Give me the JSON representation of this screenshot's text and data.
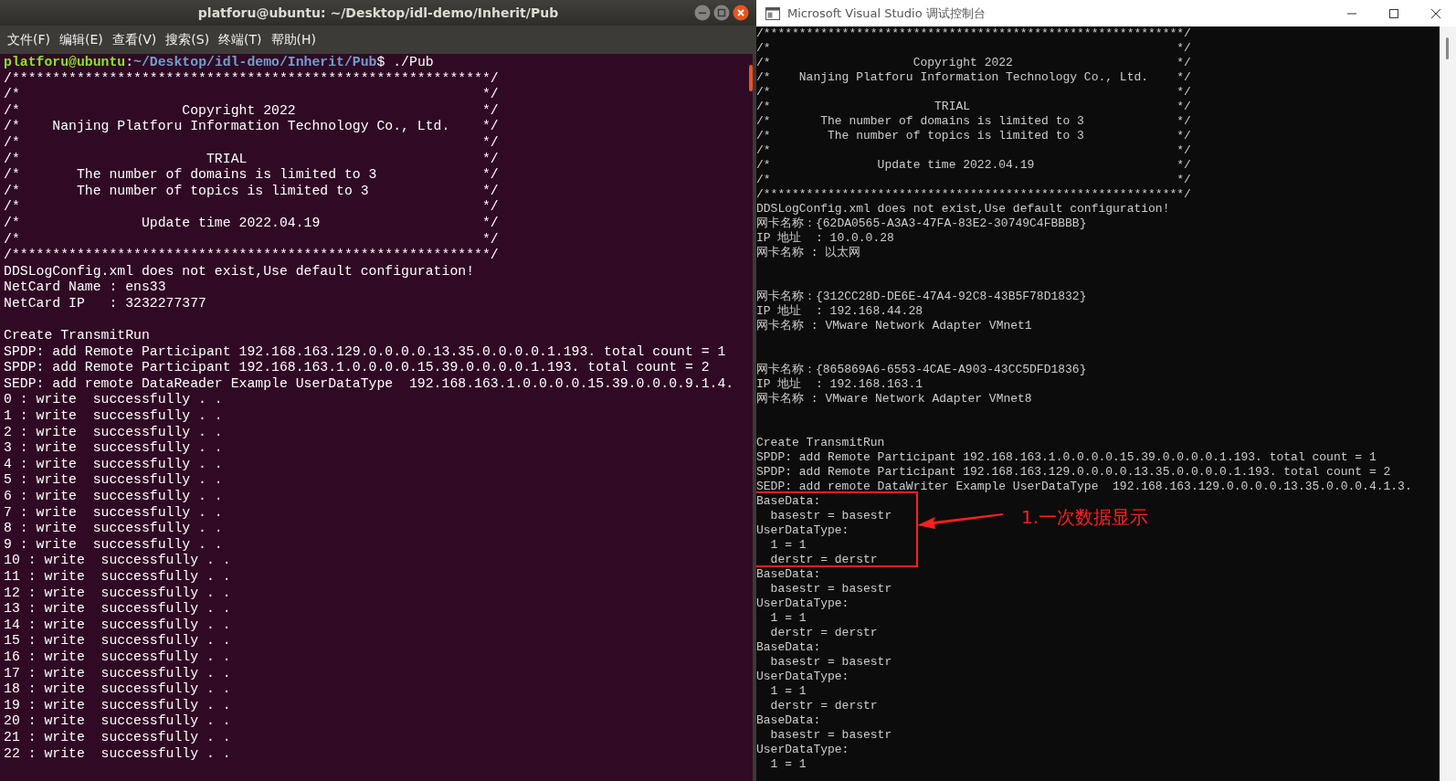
{
  "left_window": {
    "title": "platforu@ubuntu: ~/Desktop/idl-demo/Inherit/Pub",
    "menu": [
      {
        "label": "文件(F)"
      },
      {
        "label": "编辑(E)"
      },
      {
        "label": "查看(V)"
      },
      {
        "label": "搜索(S)"
      },
      {
        "label": "终端(T)"
      },
      {
        "label": "帮助(H)"
      }
    ],
    "prompt": {
      "user_host": "platforu@ubuntu",
      "separator": ":",
      "path": "~/Desktop/idl-demo/Inherit/Pub",
      "symbol": "$",
      "command": " ./Pub"
    },
    "lines": [
      {
        "kind": "text",
        "text": "/***********************************************************/"
      },
      {
        "kind": "text",
        "text": "/*                                                         */"
      },
      {
        "kind": "text",
        "text": "/*                    Copyright 2022                       */"
      },
      {
        "kind": "text",
        "text": "/*    Nanjing Platforu Information Technology Co., Ltd.    */"
      },
      {
        "kind": "text",
        "text": "/*                                                         */"
      },
      {
        "kind": "text",
        "text": "/*                       TRIAL                             */"
      },
      {
        "kind": "text",
        "text": "/*       The number of domains is limited to 3             */"
      },
      {
        "kind": "text",
        "text": "/*       The number of topics is limited to 3              */"
      },
      {
        "kind": "text",
        "text": "/*                                                         */"
      },
      {
        "kind": "text",
        "text": "/*               Update time 2022.04.19                    */"
      },
      {
        "kind": "text",
        "text": "/*                                                         */"
      },
      {
        "kind": "text",
        "text": "/***********************************************************/"
      },
      {
        "kind": "text",
        "text": "DDSLogConfig.xml does not exist,Use default configuration!"
      },
      {
        "kind": "text",
        "text": "NetCard Name : ens33"
      },
      {
        "kind": "text",
        "text": "NetCard IP   : 3232277377"
      },
      {
        "kind": "blank"
      },
      {
        "kind": "text",
        "text": "Create TransmitRun"
      },
      {
        "kind": "text",
        "text": "SPDP: add Remote Participant 192.168.163.129.0.0.0.0.13.35.0.0.0.0.1.193. total count = 1"
      },
      {
        "kind": "text",
        "text": "SPDP: add Remote Participant 192.168.163.1.0.0.0.0.15.39.0.0.0.0.1.193. total count = 2"
      },
      {
        "kind": "text",
        "text": "SEDP: add remote DataReader Example UserDataType  192.168.163.1.0.0.0.0.15.39.0.0.0.9.1.4."
      },
      {
        "kind": "text",
        "text": "0 : write  successfully . ."
      },
      {
        "kind": "text",
        "text": "1 : write  successfully . ."
      },
      {
        "kind": "text",
        "text": "2 : write  successfully . ."
      },
      {
        "kind": "text",
        "text": "3 : write  successfully . ."
      },
      {
        "kind": "text",
        "text": "4 : write  successfully . ."
      },
      {
        "kind": "text",
        "text": "5 : write  successfully . ."
      },
      {
        "kind": "text",
        "text": "6 : write  successfully . ."
      },
      {
        "kind": "text",
        "text": "7 : write  successfully . ."
      },
      {
        "kind": "text",
        "text": "8 : write  successfully . ."
      },
      {
        "kind": "text",
        "text": "9 : write  successfully . ."
      },
      {
        "kind": "text",
        "text": "10 : write  successfully . ."
      },
      {
        "kind": "text",
        "text": "11 : write  successfully . ."
      },
      {
        "kind": "text",
        "text": "12 : write  successfully . ."
      },
      {
        "kind": "text",
        "text": "13 : write  successfully . ."
      },
      {
        "kind": "text",
        "text": "14 : write  successfully . ."
      },
      {
        "kind": "text",
        "text": "15 : write  successfully . ."
      },
      {
        "kind": "text",
        "text": "16 : write  successfully . ."
      },
      {
        "kind": "text",
        "text": "17 : write  successfully . ."
      },
      {
        "kind": "text",
        "text": "18 : write  successfully . ."
      },
      {
        "kind": "text",
        "text": "19 : write  successfully . ."
      },
      {
        "kind": "text",
        "text": "20 : write  successfully . ."
      },
      {
        "kind": "text",
        "text": "21 : write  successfully . ."
      },
      {
        "kind": "text",
        "text": "22 : write  successfully . ."
      }
    ]
  },
  "right_window": {
    "title": "Microsoft Visual Studio 调试控制台",
    "lines": [
      {
        "kind": "text",
        "text": "/***********************************************************/"
      },
      {
        "kind": "text",
        "text": "/*                                                         */"
      },
      {
        "kind": "text",
        "text": "/*                    Copyright 2022                       */"
      },
      {
        "kind": "text",
        "text": "/*    Nanjing Platforu Information Technology Co., Ltd.    */"
      },
      {
        "kind": "text",
        "text": "/*                                                         */"
      },
      {
        "kind": "text",
        "text": "/*                       TRIAL                             */"
      },
      {
        "kind": "text",
        "text": "/*       The number of domains is limited to 3             */"
      },
      {
        "kind": "text",
        "text": "/*        The number of topics is limited to 3             */"
      },
      {
        "kind": "text",
        "text": "/*                                                         */"
      },
      {
        "kind": "text",
        "text": "/*               Update time 2022.04.19                    */"
      },
      {
        "kind": "text",
        "text": "/*                                                         */"
      },
      {
        "kind": "text",
        "text": "/***********************************************************/"
      },
      {
        "kind": "text",
        "text": "DDSLogConfig.xml does not exist,Use default configuration!"
      },
      {
        "kind": "text",
        "text": "网卡名称：{62DA0565-A3A3-47FA-83E2-30749C4FBBBB}"
      },
      {
        "kind": "text",
        "text": "IP 地址  : 10.0.0.28"
      },
      {
        "kind": "text",
        "text": "网卡名称 : 以太网"
      },
      {
        "kind": "blank"
      },
      {
        "kind": "blank"
      },
      {
        "kind": "text",
        "text": "网卡名称：{312CC28D-DE6E-47A4-92C8-43B5F78D1832}"
      },
      {
        "kind": "text",
        "text": "IP 地址  : 192.168.44.28"
      },
      {
        "kind": "text",
        "text": "网卡名称 : VMware Network Adapter VMnet1"
      },
      {
        "kind": "blank"
      },
      {
        "kind": "blank"
      },
      {
        "kind": "text",
        "text": "网卡名称：{865869A6-6553-4CAE-A903-43CC5DFD1836}"
      },
      {
        "kind": "text",
        "text": "IP 地址  : 192.168.163.1"
      },
      {
        "kind": "text",
        "text": "网卡名称 : VMware Network Adapter VMnet8"
      },
      {
        "kind": "blank"
      },
      {
        "kind": "blank"
      },
      {
        "kind": "text",
        "text": "Create TransmitRun"
      },
      {
        "kind": "text",
        "text": "SPDP: add Remote Participant 192.168.163.1.0.0.0.0.15.39.0.0.0.0.1.193. total count = 1"
      },
      {
        "kind": "text",
        "text": "SPDP: add Remote Participant 192.168.163.129.0.0.0.0.13.35.0.0.0.0.1.193. total count = 2"
      },
      {
        "kind": "text",
        "text": "SEDP: add remote DataWriter Example UserDataType  192.168.163.129.0.0.0.0.13.35.0.0.0.4.1.3."
      },
      {
        "kind": "text",
        "text": "BaseData:"
      },
      {
        "kind": "text",
        "text": "  basestr = basestr"
      },
      {
        "kind": "text",
        "text": "UserDataType:"
      },
      {
        "kind": "text",
        "text": "  1 = 1"
      },
      {
        "kind": "text",
        "text": "  derstr = derstr"
      },
      {
        "kind": "text",
        "text": "BaseData:"
      },
      {
        "kind": "text",
        "text": "  basestr = basestr"
      },
      {
        "kind": "text",
        "text": "UserDataType:"
      },
      {
        "kind": "text",
        "text": "  1 = 1"
      },
      {
        "kind": "text",
        "text": "  derstr = derstr"
      },
      {
        "kind": "text",
        "text": "BaseData:"
      },
      {
        "kind": "text",
        "text": "  basestr = basestr"
      },
      {
        "kind": "text",
        "text": "UserDataType:"
      },
      {
        "kind": "text",
        "text": "  1 = 1"
      },
      {
        "kind": "text",
        "text": "  derstr = derstr"
      },
      {
        "kind": "text",
        "text": "BaseData:"
      },
      {
        "kind": "text",
        "text": "  basestr = basestr"
      },
      {
        "kind": "text",
        "text": "UserDataType:"
      },
      {
        "kind": "text",
        "text": "  1 = 1"
      }
    ]
  },
  "annotation": {
    "text": "1.一次数据显示"
  }
}
